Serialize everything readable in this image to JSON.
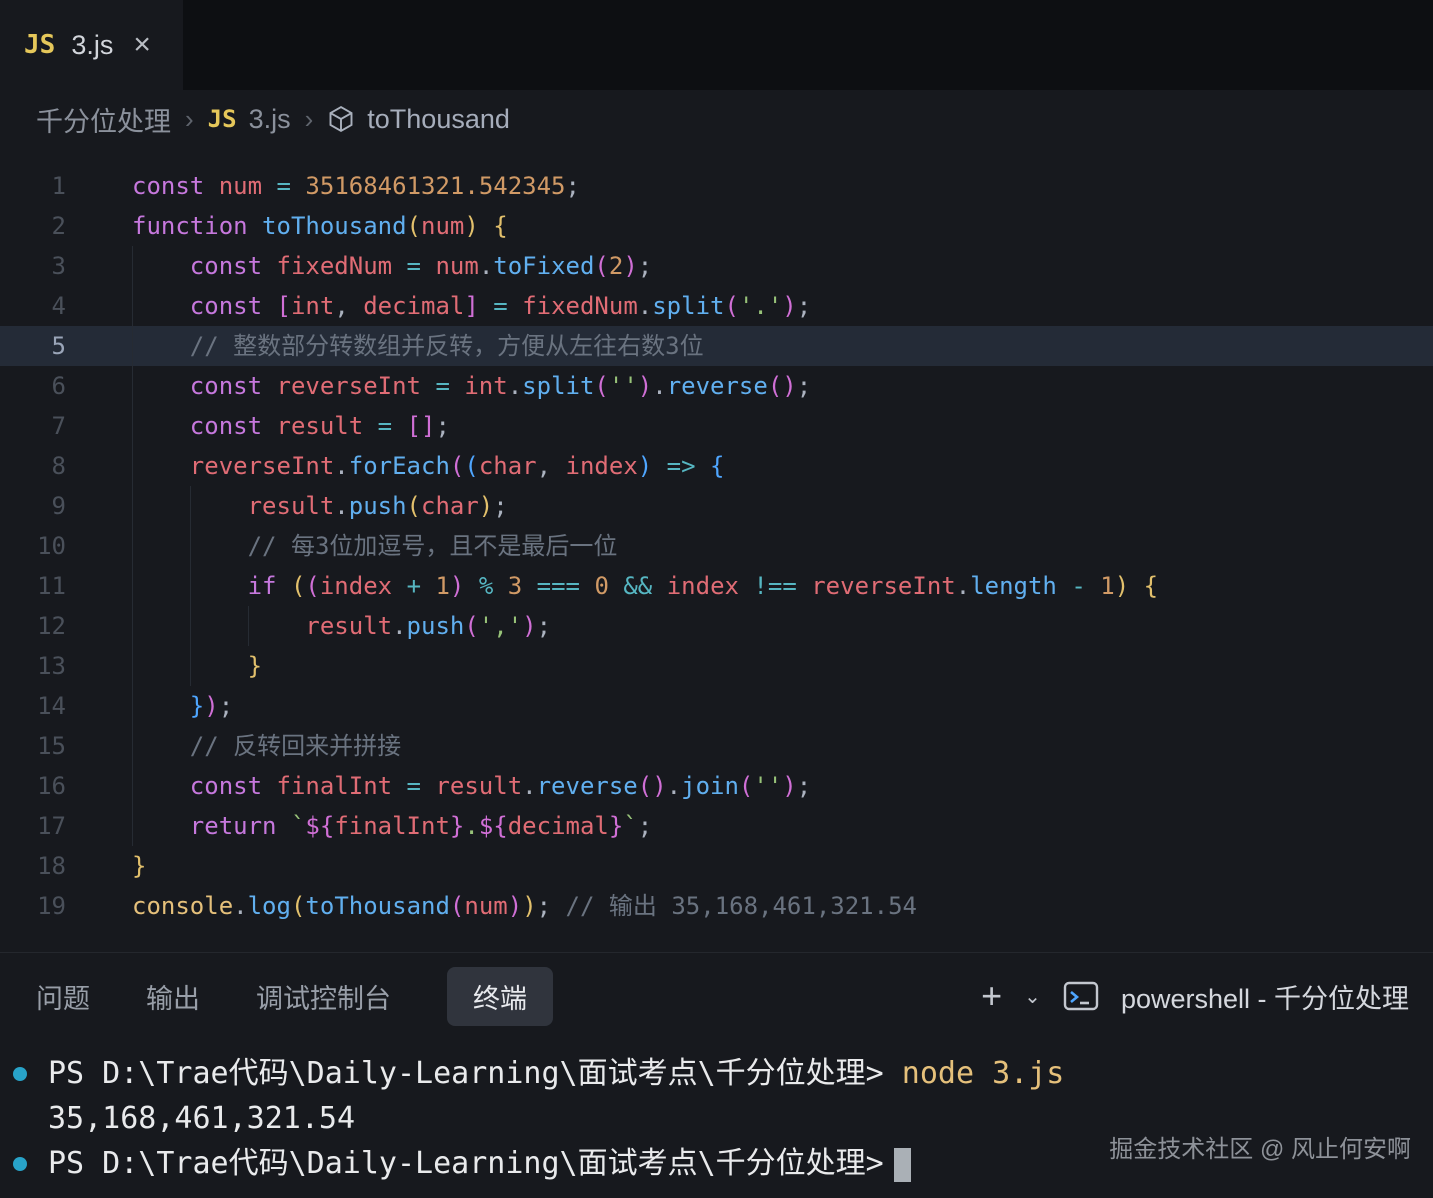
{
  "icons": {
    "plus": "+",
    "chevron_down": "⌄",
    "close": "×",
    "breadcrumb_separator": "›"
  },
  "tab": {
    "file_type_icon": "JS",
    "title": "3.js"
  },
  "breadcrumb": {
    "folder": "千分位处理",
    "file_icon": "JS",
    "file": "3.js",
    "symbol": "toThousand"
  },
  "editor": {
    "lines": [
      {
        "n": 1,
        "t": [
          [
            "kw",
            "const"
          ],
          [
            "ws",
            " "
          ],
          [
            "vr",
            "num"
          ],
          [
            "ws",
            " "
          ],
          [
            "op",
            "="
          ],
          [
            "ws",
            " "
          ],
          [
            "num",
            "35168461321.542345"
          ],
          [
            "pn",
            ";"
          ]
        ]
      },
      {
        "n": 2,
        "t": [
          [
            "kw",
            "function"
          ],
          [
            "ws",
            " "
          ],
          [
            "fn",
            "toThousand"
          ],
          [
            "b1",
            "("
          ],
          [
            "vr",
            "num"
          ],
          [
            "b1",
            ")"
          ],
          [
            "ws",
            " "
          ],
          [
            "b1",
            "{"
          ]
        ]
      },
      {
        "n": 3,
        "t": [
          [
            "ws",
            "    "
          ],
          [
            "kw",
            "const"
          ],
          [
            "ws",
            " "
          ],
          [
            "vr",
            "fixedNum"
          ],
          [
            "ws",
            " "
          ],
          [
            "op",
            "="
          ],
          [
            "ws",
            " "
          ],
          [
            "vr",
            "num"
          ],
          [
            "pn",
            "."
          ],
          [
            "fn",
            "toFixed"
          ],
          [
            "b2",
            "("
          ],
          [
            "num",
            "2"
          ],
          [
            "b2",
            ")"
          ],
          [
            "pn",
            ";"
          ]
        ]
      },
      {
        "n": 4,
        "t": [
          [
            "ws",
            "    "
          ],
          [
            "kw",
            "const"
          ],
          [
            "ws",
            " "
          ],
          [
            "b2",
            "["
          ],
          [
            "vr",
            "int"
          ],
          [
            "pn",
            ","
          ],
          [
            "ws",
            " "
          ],
          [
            "vr",
            "decimal"
          ],
          [
            "b2",
            "]"
          ],
          [
            "ws",
            " "
          ],
          [
            "op",
            "="
          ],
          [
            "ws",
            " "
          ],
          [
            "vr",
            "fixedNum"
          ],
          [
            "pn",
            "."
          ],
          [
            "fn",
            "split"
          ],
          [
            "b2",
            "("
          ],
          [
            "str",
            "'.'"
          ],
          [
            "b2",
            ")"
          ],
          [
            "pn",
            ";"
          ]
        ]
      },
      {
        "n": 5,
        "hl": true,
        "t": [
          [
            "ws",
            "    "
          ],
          [
            "cm",
            "// 整数部分转数组并反转，方便从左往右数3位"
          ]
        ]
      },
      {
        "n": 6,
        "t": [
          [
            "ws",
            "    "
          ],
          [
            "kw",
            "const"
          ],
          [
            "ws",
            " "
          ],
          [
            "vr",
            "reverseInt"
          ],
          [
            "ws",
            " "
          ],
          [
            "op",
            "="
          ],
          [
            "ws",
            " "
          ],
          [
            "vr",
            "int"
          ],
          [
            "pn",
            "."
          ],
          [
            "fn",
            "split"
          ],
          [
            "b2",
            "("
          ],
          [
            "str",
            "''"
          ],
          [
            "b2",
            ")"
          ],
          [
            "pn",
            "."
          ],
          [
            "fn",
            "reverse"
          ],
          [
            "b2",
            "("
          ],
          [
            "b2",
            ")"
          ],
          [
            "pn",
            ";"
          ]
        ]
      },
      {
        "n": 7,
        "t": [
          [
            "ws",
            "    "
          ],
          [
            "kw",
            "const"
          ],
          [
            "ws",
            " "
          ],
          [
            "vr",
            "result"
          ],
          [
            "ws",
            " "
          ],
          [
            "op",
            "="
          ],
          [
            "ws",
            " "
          ],
          [
            "b2",
            "["
          ],
          [
            "b2",
            "]"
          ],
          [
            "pn",
            ";"
          ]
        ]
      },
      {
        "n": 8,
        "t": [
          [
            "ws",
            "    "
          ],
          [
            "vr",
            "reverseInt"
          ],
          [
            "pn",
            "."
          ],
          [
            "fn",
            "forEach"
          ],
          [
            "b2",
            "("
          ],
          [
            "b3",
            "("
          ],
          [
            "vr",
            "char"
          ],
          [
            "pn",
            ","
          ],
          [
            "ws",
            " "
          ],
          [
            "vr",
            "index"
          ],
          [
            "b3",
            ")"
          ],
          [
            "ws",
            " "
          ],
          [
            "op",
            "=>"
          ],
          [
            "ws",
            " "
          ],
          [
            "b3",
            "{"
          ]
        ]
      },
      {
        "n": 9,
        "t": [
          [
            "ws",
            "        "
          ],
          [
            "vr",
            "result"
          ],
          [
            "pn",
            "."
          ],
          [
            "fn",
            "push"
          ],
          [
            "b1",
            "("
          ],
          [
            "vr",
            "char"
          ],
          [
            "b1",
            ")"
          ],
          [
            "pn",
            ";"
          ]
        ]
      },
      {
        "n": 10,
        "t": [
          [
            "ws",
            "        "
          ],
          [
            "cm",
            "// 每3位加逗号，且不是最后一位"
          ]
        ]
      },
      {
        "n": 11,
        "t": [
          [
            "ws",
            "        "
          ],
          [
            "kw",
            "if"
          ],
          [
            "ws",
            " "
          ],
          [
            "b1",
            "("
          ],
          [
            "b2",
            "("
          ],
          [
            "vr",
            "index"
          ],
          [
            "ws",
            " "
          ],
          [
            "op",
            "+"
          ],
          [
            "ws",
            " "
          ],
          [
            "num",
            "1"
          ],
          [
            "b2",
            ")"
          ],
          [
            "ws",
            " "
          ],
          [
            "op",
            "%"
          ],
          [
            "ws",
            " "
          ],
          [
            "num",
            "3"
          ],
          [
            "ws",
            " "
          ],
          [
            "op",
            "==="
          ],
          [
            "ws",
            " "
          ],
          [
            "num",
            "0"
          ],
          [
            "ws",
            " "
          ],
          [
            "op",
            "&&"
          ],
          [
            "ws",
            " "
          ],
          [
            "vr",
            "index"
          ],
          [
            "ws",
            " "
          ],
          [
            "op",
            "!=="
          ],
          [
            "ws",
            " "
          ],
          [
            "vr",
            "reverseInt"
          ],
          [
            "pn",
            "."
          ],
          [
            "fn",
            "length"
          ],
          [
            "ws",
            " "
          ],
          [
            "op",
            "-"
          ],
          [
            "ws",
            " "
          ],
          [
            "num",
            "1"
          ],
          [
            "b1",
            ")"
          ],
          [
            "ws",
            " "
          ],
          [
            "b1",
            "{"
          ]
        ]
      },
      {
        "n": 12,
        "t": [
          [
            "ws",
            "            "
          ],
          [
            "vr",
            "result"
          ],
          [
            "pn",
            "."
          ],
          [
            "fn",
            "push"
          ],
          [
            "b2",
            "("
          ],
          [
            "str",
            "','"
          ],
          [
            "b2",
            ")"
          ],
          [
            "pn",
            ";"
          ]
        ]
      },
      {
        "n": 13,
        "t": [
          [
            "ws",
            "        "
          ],
          [
            "b1",
            "}"
          ]
        ]
      },
      {
        "n": 14,
        "t": [
          [
            "ws",
            "    "
          ],
          [
            "b3",
            "}"
          ],
          [
            "b2",
            ")"
          ],
          [
            "pn",
            ";"
          ]
        ]
      },
      {
        "n": 15,
        "t": [
          [
            "ws",
            "    "
          ],
          [
            "cm",
            "// 反转回来并拼接"
          ]
        ]
      },
      {
        "n": 16,
        "t": [
          [
            "ws",
            "    "
          ],
          [
            "kw",
            "const"
          ],
          [
            "ws",
            " "
          ],
          [
            "vr",
            "finalInt"
          ],
          [
            "ws",
            " "
          ],
          [
            "op",
            "="
          ],
          [
            "ws",
            " "
          ],
          [
            "vr",
            "result"
          ],
          [
            "pn",
            "."
          ],
          [
            "fn",
            "reverse"
          ],
          [
            "b2",
            "("
          ],
          [
            "b2",
            ")"
          ],
          [
            "pn",
            "."
          ],
          [
            "fn",
            "join"
          ],
          [
            "b2",
            "("
          ],
          [
            "str",
            "''"
          ],
          [
            "b2",
            ")"
          ],
          [
            "pn",
            ";"
          ]
        ]
      },
      {
        "n": 17,
        "t": [
          [
            "ws",
            "    "
          ],
          [
            "kw",
            "return"
          ],
          [
            "ws",
            " "
          ],
          [
            "str",
            "`"
          ],
          [
            "b2",
            "${"
          ],
          [
            "vr",
            "finalInt"
          ],
          [
            "b2",
            "}"
          ],
          [
            "str",
            "."
          ],
          [
            "b2",
            "${"
          ],
          [
            "vr",
            "decimal"
          ],
          [
            "b2",
            "}"
          ],
          [
            "str",
            "`"
          ],
          [
            "pn",
            ";"
          ]
        ]
      },
      {
        "n": 18,
        "t": [
          [
            "b1",
            "}"
          ]
        ]
      },
      {
        "n": 19,
        "t": [
          [
            "cons",
            "console"
          ],
          [
            "pn",
            "."
          ],
          [
            "fn",
            "log"
          ],
          [
            "b1",
            "("
          ],
          [
            "fn",
            "toThousand"
          ],
          [
            "b2",
            "("
          ],
          [
            "vr",
            "num"
          ],
          [
            "b2",
            ")"
          ],
          [
            "b1",
            ")"
          ],
          [
            "pn",
            ";"
          ],
          [
            "ws",
            " "
          ],
          [
            "cm",
            "// 输出 35,168,461,321.54"
          ]
        ]
      }
    ]
  },
  "panel": {
    "tabs": [
      {
        "id": "problems",
        "label": "问题",
        "active": false
      },
      {
        "id": "output",
        "label": "输出",
        "active": false
      },
      {
        "id": "debug-console",
        "label": "调试控制台",
        "active": false
      },
      {
        "id": "terminal",
        "label": "终端",
        "active": true
      }
    ],
    "shell_label": "powershell - 千分位处理"
  },
  "terminal": {
    "lines": [
      {
        "bullet": true,
        "segments": [
          [
            "prompt",
            "PS D:\\Trae代码\\Daily-Learning\\面试考点\\千分位处理>"
          ],
          [
            "cmd",
            " node 3.js"
          ]
        ]
      },
      {
        "bullet": false,
        "segments": [
          [
            "out",
            "35,168,461,321.54"
          ]
        ]
      },
      {
        "bullet": true,
        "segments": [
          [
            "prompt",
            "PS D:\\Trae代码\\Daily-Learning\\面试考点\\千分位处理>"
          ],
          [
            "cursor",
            ""
          ]
        ]
      }
    ]
  },
  "footer": {
    "watermark": "掘金技术社区 @ 风止何安啊"
  },
  "colors": {
    "editor_bg": "#17191e",
    "tabbar_bg": "#0d0f12",
    "line_highlight": "#242b37",
    "accent_command_decoration": "#28a3c9",
    "command_yellow": "#e5c07b"
  }
}
